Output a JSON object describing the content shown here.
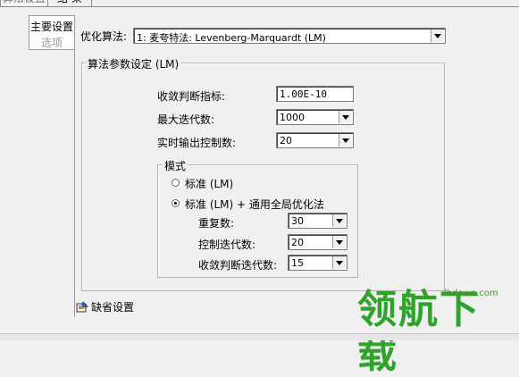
{
  "tabs": [
    "算法设置",
    "结 果"
  ],
  "side_tab": {
    "label": "主要设置",
    "second": "选项"
  },
  "optimizer": {
    "label": "优化算法:",
    "value": "1: 麦夸特法: Levenberg-Marquardt (LM)"
  },
  "params_group": {
    "title": "算法参数设定 (LM)",
    "convergence": {
      "label": "收敛判断指标:",
      "value": "1.00E-10"
    },
    "max_iter": {
      "label": "最大迭代数:",
      "value": "1000"
    },
    "realtime": {
      "label": "实时输出控制数:",
      "value": "20"
    }
  },
  "mode_group": {
    "title": "模式",
    "option1": "标准 (LM)",
    "option2": "标准 (LM) + 通用全局优化法",
    "selected": 2,
    "repeat": {
      "label": "重复数:",
      "value": "30"
    },
    "ctrl_iter": {
      "label": "控制迭代数:",
      "value": "20"
    },
    "conv_iter": {
      "label": "收敛判断迭代数:",
      "value": "15"
    }
  },
  "defaults_button": "缺省设置",
  "watermark": {
    "text": "领航下载",
    "url": "lhdown.com"
  }
}
